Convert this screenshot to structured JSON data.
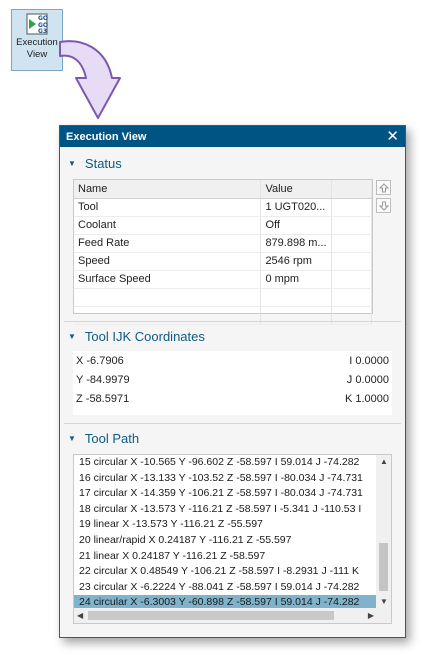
{
  "launcher": {
    "label_line1": "Execution",
    "label_line2": "View",
    "icon": "go-gcode-icon",
    "glyph_text": [
      "GO",
      "GO",
      "G3"
    ]
  },
  "window": {
    "title": "Execution View",
    "close_icon": "close-icon"
  },
  "status": {
    "header": "Status",
    "columns": [
      "Name",
      "Value",
      ""
    ],
    "rows": [
      {
        "name": "Tool",
        "value": "1   UGT020..."
      },
      {
        "name": "Coolant",
        "value": "Off"
      },
      {
        "name": "Feed Rate",
        "value": "879.898 m..."
      },
      {
        "name": "Speed",
        "value": "2546 rpm"
      },
      {
        "name": "Surface Speed",
        "value": "0 mpm"
      },
      {
        "name": "",
        "value": ""
      },
      {
        "name": "",
        "value": ""
      }
    ]
  },
  "ijk": {
    "header": "Tool IJK Coordinates",
    "rows": [
      {
        "axis": "X -6.7906",
        "dir": "I 0.0000"
      },
      {
        "axis": "Y -84.9979",
        "dir": "J 0.0000"
      },
      {
        "axis": "Z -58.5971",
        "dir": "K 1.0000"
      }
    ]
  },
  "toolpath": {
    "header": "Tool Path",
    "lines": [
      "15 circular  X -10.565 Y -96.602 Z -58.597 I 59.014 J -74.282",
      "16 circular  X -13.133 Y -103.52 Z -58.597 I -80.034 J -74.731",
      "17 circular  X -14.359 Y -106.21 Z -58.597 I -80.034 J -74.731",
      "18 circular  X -13.573 Y -116.21 Z -58.597 I -5.341 J -110.53 I",
      "19 linear X -13.573 Y -116.21 Z -55.597",
      "20 linear/rapid X 0.24187 Y -116.21 Z -55.597",
      "21 linear X 0.24187 Y -116.21 Z -58.597",
      "22 circular  X 0.48549 Y -106.21 Z -58.597 I -8.2931 J -111 K",
      "23 circular  X -6.2224 Y -88.041 Z -58.597 I 59.014 J -74.282",
      "24 circular  X -6.3003 Y -60.898 Z -58.597 I 59.014 J -74.282"
    ],
    "selected_index": 9
  },
  "colors": {
    "titlebar": "#005483",
    "section_text": "#0f5a86",
    "selection": "#7fb3cc",
    "launcher_bg": "#cfe3f1",
    "arrow_fill": "#e6dcf5",
    "arrow_stroke": "#7b59b0"
  }
}
